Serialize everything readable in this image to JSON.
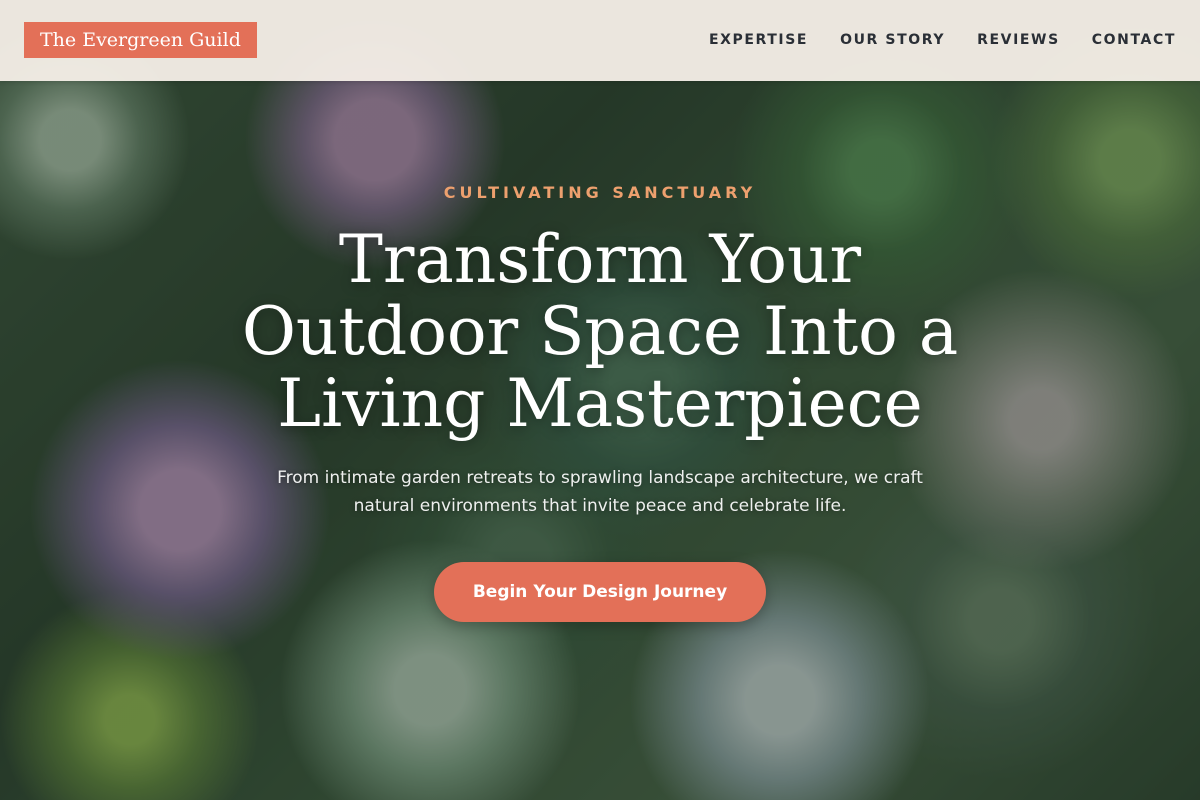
{
  "header": {
    "logo_text": "The Evergreen Guild",
    "nav": [
      {
        "label": "EXPERTISE"
      },
      {
        "label": "OUR STORY"
      },
      {
        "label": "REVIEWS"
      },
      {
        "label": "CONTACT"
      }
    ]
  },
  "hero": {
    "background_image": "succulent-garden-photo",
    "eyebrow": "CULTIVATING SANCTUARY",
    "headline": "Transform Your Outdoor Space Into a Living Masterpiece",
    "subtext": "From intimate garden retreats to sprawling landscape architecture, we craft natural environments that invite peace and celebrate life.",
    "cta_label": "Begin Your Design Journey"
  },
  "colors": {
    "accent": "#e37058",
    "eyebrow": "#eda06e",
    "header_bg": "#f6efe8",
    "nav_text": "#2a2f36"
  }
}
